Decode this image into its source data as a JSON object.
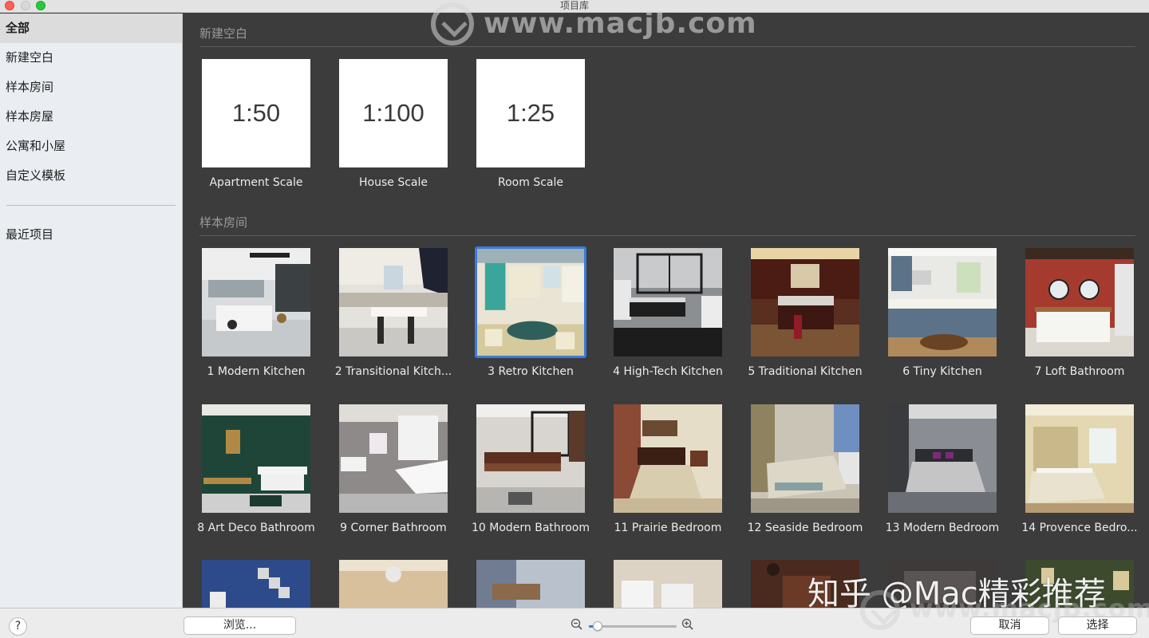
{
  "window": {
    "title": "项目库"
  },
  "sidebar": {
    "items": [
      {
        "label": "全部"
      },
      {
        "label": "新建空白"
      },
      {
        "label": "样本房间"
      },
      {
        "label": "样本房屋"
      },
      {
        "label": "公寓和小屋"
      },
      {
        "label": "自定义模板"
      }
    ],
    "recent_label": "最近项目"
  },
  "blank_section": {
    "title": "新建空白",
    "tiles": [
      {
        "scale": "1:50",
        "label": "Apartment Scale"
      },
      {
        "scale": "1:100",
        "label": "House Scale"
      },
      {
        "scale": "1:25",
        "label": "Room Scale"
      }
    ]
  },
  "rooms_section": {
    "title": "样本房间",
    "tiles": [
      {
        "label": "1 Modern Kitchen"
      },
      {
        "label": "2 Transitional Kitch..."
      },
      {
        "label": "3 Retro Kitchen"
      },
      {
        "label": "4 High-Tech Kitchen"
      },
      {
        "label": "5 Traditional Kitchen"
      },
      {
        "label": "6 Tiny Kitchen"
      },
      {
        "label": "7 Loft Bathroom"
      },
      {
        "label": "8 Art Deco Bathroom"
      },
      {
        "label": "9 Corner Bathroom"
      },
      {
        "label": "10 Modern Bathroom"
      },
      {
        "label": "11 Prairie Bedroom"
      },
      {
        "label": "12 Seaside Bedroom"
      },
      {
        "label": "13 Modern Bedroom"
      },
      {
        "label": "14 Provence Bedro..."
      }
    ],
    "selected_index": 2
  },
  "watermark": {
    "text": "www.macjb.com",
    "zhihu": "知乎 @Mac精彩推荐",
    "bottom_text": "www.macjb.com"
  },
  "bottom": {
    "help_label": "?",
    "browse_label": "浏览...",
    "cancel_label": "取消",
    "choose_label": "选择",
    "zoom_level": 0.1
  },
  "colors": {
    "accent": "#3a7bd8",
    "main_bg": "#3c3c3c",
    "sidebar_bg": "#eaedf2"
  }
}
